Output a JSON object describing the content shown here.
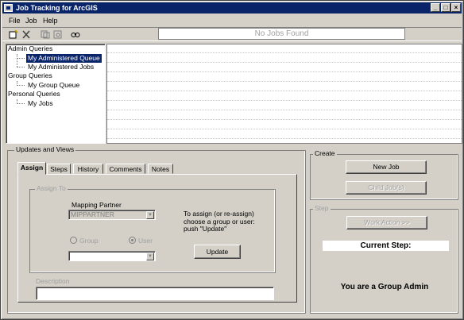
{
  "window": {
    "title": "Job Tracking for ArcGIS",
    "min": "_",
    "max": "□",
    "close": "×"
  },
  "menu": {
    "file": "File",
    "job": "Job",
    "help": "Help"
  },
  "toolbar": {
    "icons": [
      "new-job-icon",
      "delete-icon",
      "copy-icon",
      "query-icon",
      "find-icon"
    ]
  },
  "status": {
    "text": "No Jobs Found"
  },
  "tree": {
    "admin": "Admin Queries",
    "admin_queue": "My Administered Queue",
    "admin_jobs": "My Administered Jobs",
    "group": "Group Queries",
    "group_queue": "My Group Queue",
    "personal": "Personal Queries",
    "personal_jobs": "My Jobs"
  },
  "updates": {
    "legend": "Updates and Views",
    "tabs": [
      "Assign",
      "Steps",
      "History",
      "Comments",
      "Notes"
    ],
    "assign_to": "Assign To",
    "mapping_partner_label": "Mapping Partner",
    "mapping_partner_value": "MIPPARTNER",
    "instructions_line1": "To assign (or re-assign)",
    "instructions_line2": "choose a group or user:",
    "instructions_line3": "push \"Update\"",
    "radio_group": "Group",
    "radio_user": "User",
    "update_button": "Update",
    "description_label": "Description"
  },
  "create": {
    "legend": "Create",
    "new_job": "New Job",
    "child_jobs": "Child Job(s)"
  },
  "step": {
    "legend": "Step",
    "work_action": "Work Action >>",
    "current_step": "Current Step:",
    "group_admin": "You are a Group Admin"
  }
}
